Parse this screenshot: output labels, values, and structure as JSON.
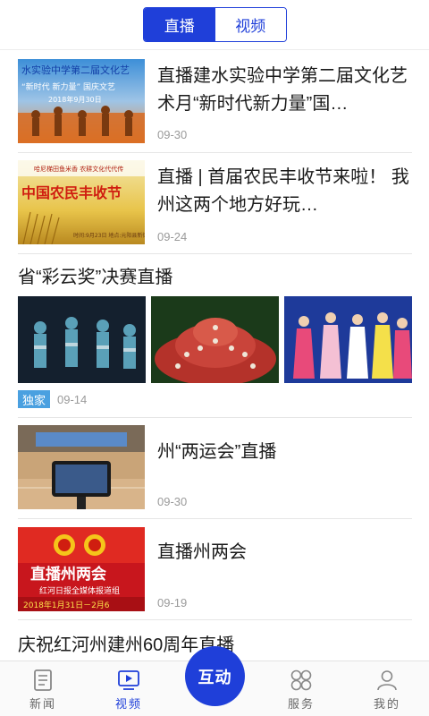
{
  "top_tabs": [
    {
      "label": "直播",
      "active": true
    },
    {
      "label": "视频",
      "active": false
    }
  ],
  "feed": {
    "item1": {
      "title": "直播建水实验中学第二届文化艺术月“新时代新力量”国…",
      "date": "09-30",
      "thumb_caption": "水实验中学第二届文化艺",
      "thumb_sub": "“新时代 新力量” 国庆文艺",
      "thumb_date": "2018年9月30日"
    },
    "item2": {
      "title": "直播 | 首届农民丰收节来啦！ 我州这两个地方好玩…",
      "date": "09-24",
      "thumb_top": "哈尼梯田鱼米香  农耕文化代代传",
      "thumb_main": "中国农民丰收节",
      "thumb_info": "时间:9月23日 地点:元阳县新街镇"
    },
    "section": {
      "title": "省“彩云奖”决赛直播",
      "badge": "独家",
      "date": "09-14"
    },
    "item3": {
      "title": "州“两运会”直播",
      "date": "09-30"
    },
    "item4": {
      "title": "直播州两会",
      "date": "09-19",
      "thumb_main": "直播州两会",
      "thumb_sub": "红河日报全媒体报道组",
      "thumb_date": "2018年1月31日－2月6"
    },
    "item5": {
      "title": "庆祝红河州建州60周年直播"
    }
  },
  "bottom_nav": {
    "news": "新闻",
    "video": "视频",
    "center": "互动",
    "service": "服务",
    "mine": "我的"
  },
  "colors": {
    "accent": "#1f3fd9",
    "badge": "#4aa0e0",
    "date": "#9a9a9a"
  }
}
